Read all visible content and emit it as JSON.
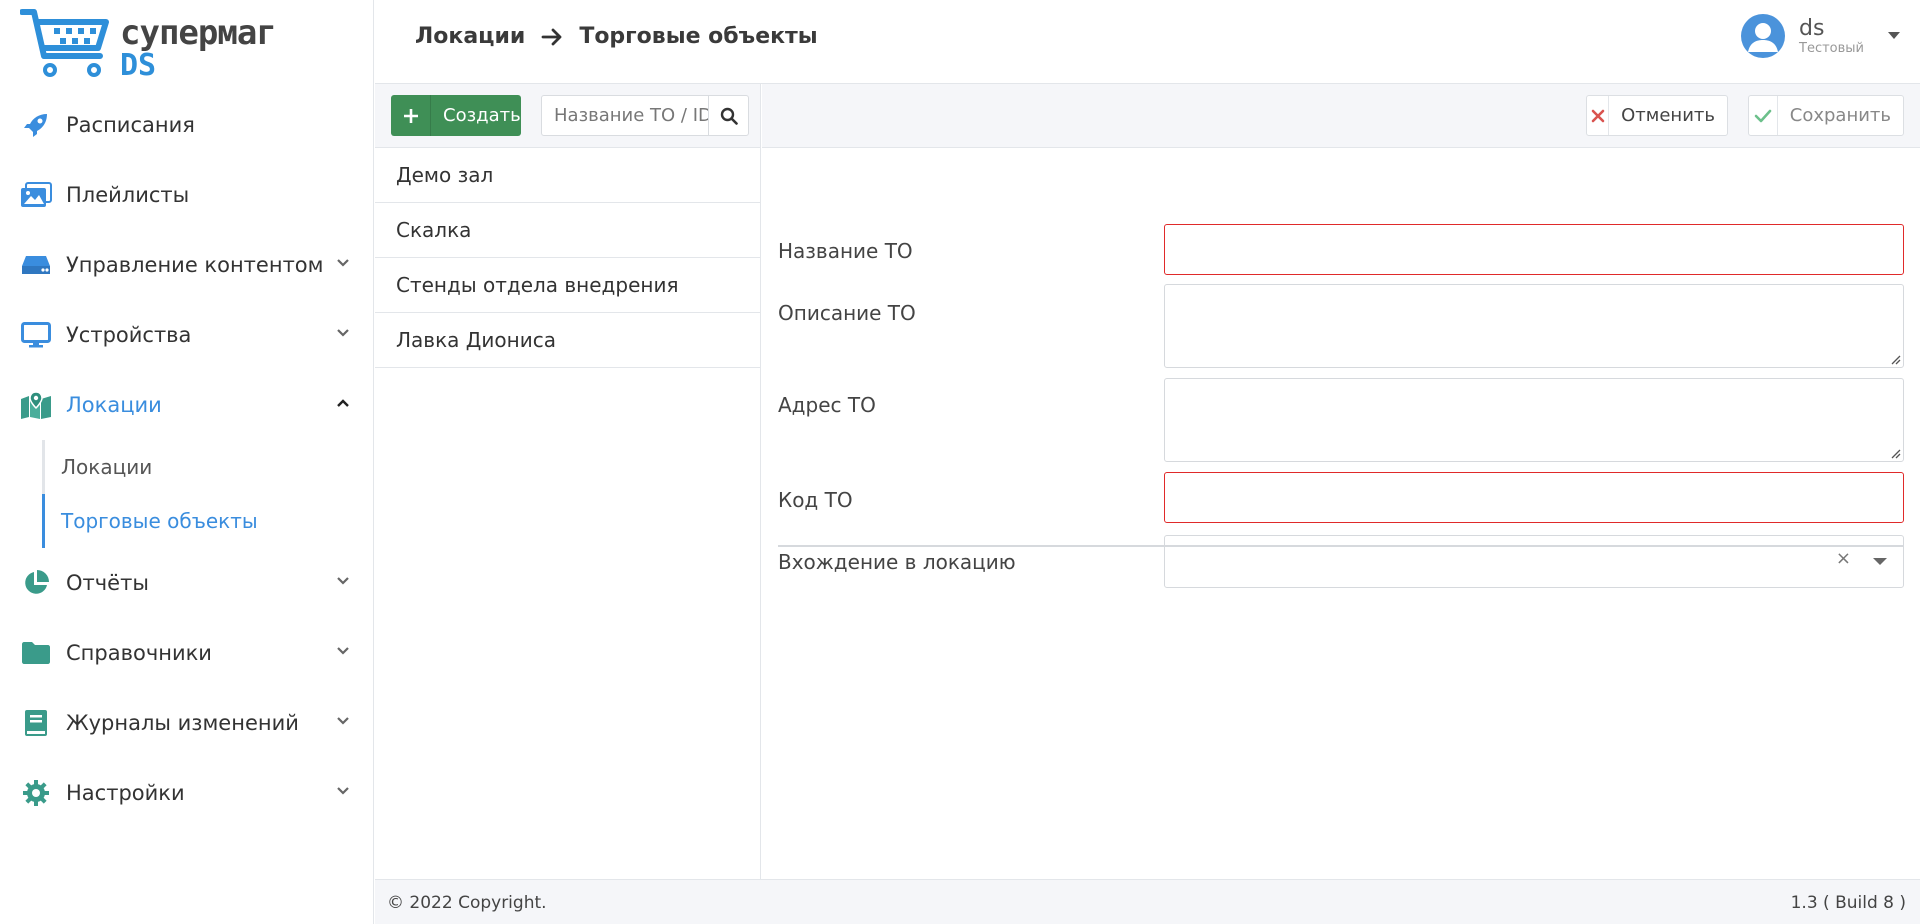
{
  "brand": {
    "name": "супермаг",
    "sub": "DS"
  },
  "nav": {
    "items": [
      {
        "label": "Расписания",
        "icon": "rocket-icon"
      },
      {
        "label": "Плейлисты",
        "icon": "images-icon"
      },
      {
        "label": "Управление контентом",
        "icon": "hdd-icon"
      },
      {
        "label": "Устройства",
        "icon": "monitor-icon"
      },
      {
        "label": "Локации",
        "icon": "map-marker-icon"
      },
      {
        "label": "Отчёты",
        "icon": "pie-chart-icon"
      },
      {
        "label": "Справочники",
        "icon": "folder-icon"
      },
      {
        "label": "Журналы изменений",
        "icon": "book-icon"
      },
      {
        "label": "Настройки",
        "icon": "gear-icon"
      }
    ],
    "sub": [
      {
        "label": "Локации"
      },
      {
        "label": "Торговые объекты"
      }
    ]
  },
  "header": {
    "crumb1": "Локации",
    "crumb2": "Торговые объекты",
    "user": {
      "name": "ds",
      "role": "Тестовый"
    }
  },
  "list": {
    "create_label": "Создать",
    "search_placeholder": "Название ТО / ID",
    "items": [
      "Демо зал",
      "Скалка",
      "Стенды отдела внедрения",
      "Лавка Диониса"
    ]
  },
  "form": {
    "cancel_label": "Отменить",
    "save_label": "Сохранить",
    "name_label": "Название ТО",
    "desc_label": "Описание ТО",
    "addr_label": "Адрес ТО",
    "code_label": "Код ТО",
    "parent_label": "Вхождение в локацию"
  },
  "footer": {
    "copyright": "© 2022 Copyright.",
    "version": "1.3 ( Build 8 )"
  },
  "colors": {
    "accent": "#3a8dde",
    "create": "#3f8f56",
    "icon": "#3a9b8a",
    "error": "#e02a2a"
  }
}
